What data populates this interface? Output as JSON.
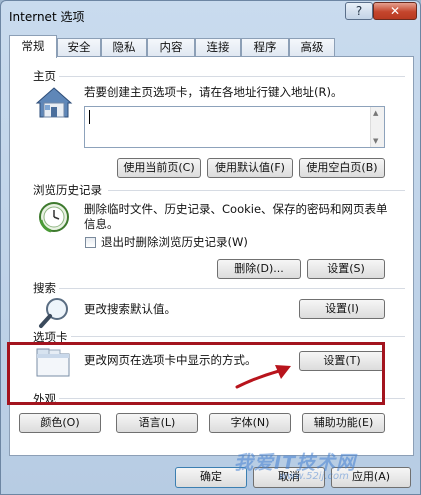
{
  "window": {
    "title": "Internet 选项",
    "help": "?",
    "close": "✕"
  },
  "tabs": [
    "常规",
    "安全",
    "隐私",
    "内容",
    "连接",
    "程序",
    "高级"
  ],
  "home": {
    "title": "主页",
    "desc": "若要创建主页选项卡，请在各地址行键入地址(R)。",
    "address_value": "",
    "buttons": [
      "使用当前页(C)",
      "使用默认值(F)",
      "使用空白页(B)"
    ]
  },
  "history": {
    "title": "浏览历史记录",
    "desc": "删除临时文件、历史记录、Cookie、保存的密码和网页表单信息。",
    "checkbox_label": "退出时删除浏览历史记录(W)",
    "checkbox_checked": false,
    "delete": "删除(D)...",
    "settings": "设置(S)"
  },
  "search": {
    "title": "搜索",
    "desc": "更改搜索默认值。",
    "settings": "设置(I)"
  },
  "tabs_section": {
    "title": "选项卡",
    "desc": "更改网页在选项卡中显示的方式。",
    "settings": "设置(T)"
  },
  "appearance": {
    "title": "外观",
    "buttons": [
      "颜色(O)",
      "语言(L)",
      "字体(N)",
      "辅助功能(E)"
    ]
  },
  "footer": {
    "ok": "确定",
    "cancel": "取消",
    "apply": "应用(A)"
  },
  "watermark": {
    "text": "我爱IT技术网",
    "sub": "www.52ij.com"
  },
  "colors": {
    "highlight": "#a3141e",
    "arrow": "#b8141c"
  }
}
